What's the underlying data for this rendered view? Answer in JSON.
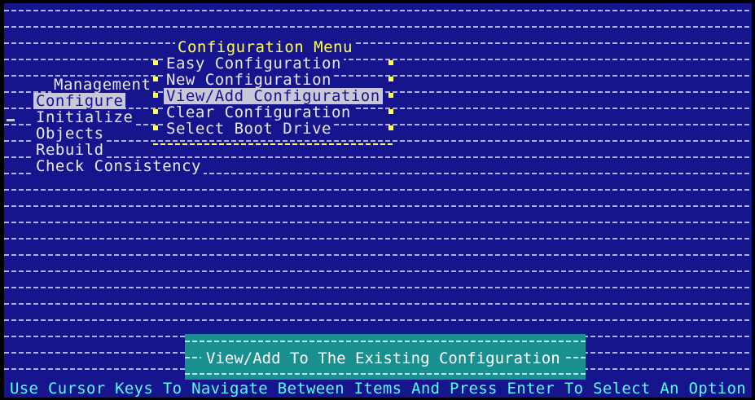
{
  "config_menu": {
    "title": "Configuration Menu",
    "items": [
      {
        "label": "Easy Configuration"
      },
      {
        "label": "New Configuration"
      },
      {
        "label": "View/Add Configuration"
      },
      {
        "label": "Clear Configuration"
      },
      {
        "label": "Select Boot Drive"
      }
    ],
    "selected_index": 2
  },
  "main_menu": {
    "items": [
      {
        "label": "Management"
      },
      {
        "label": "Configure"
      },
      {
        "label": "Initialize"
      },
      {
        "label": "Objects"
      },
      {
        "label": "Rebuild"
      },
      {
        "label": "Check Consistency"
      }
    ],
    "selected": "Configure"
  },
  "status": {
    "description": "View/Add To The Existing Configuration"
  },
  "help": {
    "text": "Use Cursor Keys To Navigate Between Items And Press Enter To Select An Option"
  },
  "colors": {
    "background": "#16158e",
    "highlight": "#c8c8d8",
    "menu_title": "#ffff54",
    "status_box": "#1a8f8f",
    "help_text": "#54ffff"
  }
}
